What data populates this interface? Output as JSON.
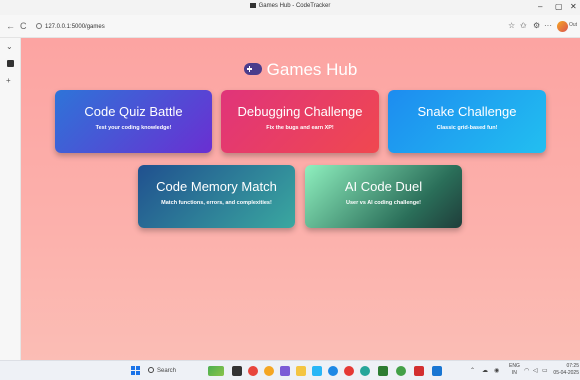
{
  "window": {
    "title": "Games Hub - CodeTracker",
    "controls": {
      "minimize": "–",
      "maximize": "▢",
      "close": "✕"
    }
  },
  "browser": {
    "url": "127.0.0.1:5000/games",
    "nav": {
      "back": "←",
      "refresh": "C",
      "info": "ⓘ"
    },
    "toolbar_icons": [
      "star-icon",
      "favorites-icon",
      "extensions-icon",
      "more-icon"
    ],
    "more": "···",
    "profile_label": "Out"
  },
  "page": {
    "title": "Games Hub",
    "title_icon": "gamepad-icon",
    "cards": [
      {
        "title": "Code Quiz Battle",
        "subtitle": "Test your coding knowledge!"
      },
      {
        "title": "Debugging Challenge",
        "subtitle": "Fix the bugs and earn XP!"
      },
      {
        "title": "Snake Challenge",
        "subtitle": "Classic grid-based fun!"
      },
      {
        "title": "Code Memory Match",
        "subtitle": "Match functions, errors, and complexities!"
      },
      {
        "title": "AI Code Duel",
        "subtitle": "User vs AI coding challenge!"
      }
    ]
  },
  "taskbar": {
    "search_label": "Search",
    "lang": {
      "line1": "ENG",
      "line2": "IN"
    },
    "clock": {
      "time": "07:25",
      "date": "05-04-2025"
    }
  },
  "colors": {
    "page_bg": "#fca4a2",
    "card_quiz": "#2e74d8",
    "card_debug": "#e0347a",
    "card_snake": "#1d8cf0",
    "card_memory": "#20508f",
    "card_duel": "#3aa8a0"
  }
}
